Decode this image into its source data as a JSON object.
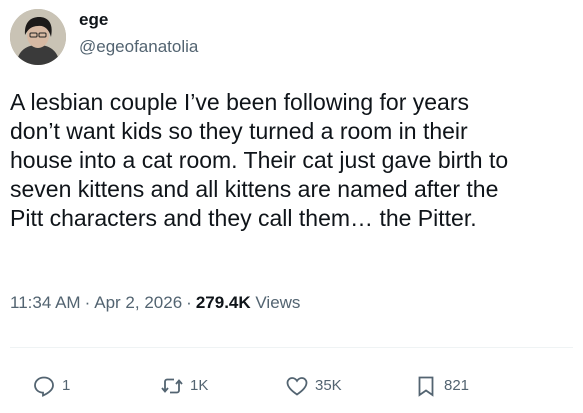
{
  "author": {
    "display_name": "ege",
    "handle": "@egeofanatolia"
  },
  "tweet": {
    "text": "A lesbian couple I’ve been following for years\ndon’t want kids so they turned a room in their\nhouse into a cat room. Their cat just gave birth to\nseven kittens and all kittens are named after the\nPitt characters and they call them… the Pitter.",
    "time": "11:34 AM",
    "date": "Apr 2, 2026",
    "views_count": "279.4K",
    "views_label": "Views",
    "separator": "·"
  },
  "actions": {
    "reply_count": "1",
    "retweet_count": "1K",
    "like_count": "35K",
    "bookmark_count": "821"
  },
  "icons": {
    "reply": "reply-icon",
    "retweet": "retweet-icon",
    "like": "heart-icon",
    "bookmark": "bookmark-icon"
  },
  "colors": {
    "text_primary": "#0f1419",
    "text_secondary": "#536471",
    "divider": "#eff3f4"
  }
}
